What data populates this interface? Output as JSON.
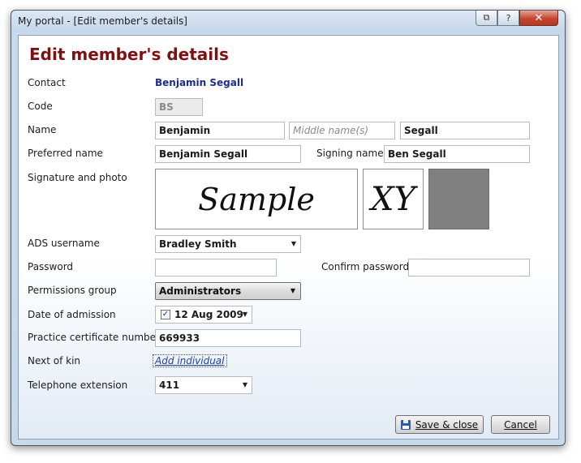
{
  "window": {
    "title": "My portal - [Edit member's details]",
    "controls": {
      "restore": "⧉",
      "help": "?",
      "close": "✕"
    }
  },
  "form": {
    "heading": "Edit member's details",
    "contact": {
      "label": "Contact",
      "value": "Benjamin Segall"
    },
    "code": {
      "label": "Code",
      "value": "BS"
    },
    "name": {
      "label": "Name",
      "first": "Benjamin",
      "middle_placeholder": "Middle name(s)",
      "last": "Segall"
    },
    "preferred_name": {
      "label": "Preferred name",
      "value": "Benjamin Segall"
    },
    "signing_name": {
      "label": "Signing name",
      "value": "Ben Segall"
    },
    "signature_photo": {
      "label": "Signature and photo",
      "signature_text": "Sample",
      "initials_text": "XY"
    },
    "ads_username": {
      "label": "ADS username",
      "value": "Bradley Smith"
    },
    "password": {
      "label": "Password",
      "value": ""
    },
    "confirm_password": {
      "label": "Confirm password",
      "value": ""
    },
    "permissions_group": {
      "label": "Permissions group",
      "value": "Administrators"
    },
    "date_of_admission": {
      "label": "Date of admission",
      "value": "12 Aug 2009",
      "checked": true
    },
    "practice_certificate": {
      "label": "Practice certificate number",
      "value": "669933"
    },
    "next_of_kin": {
      "label": "Next of kin",
      "link": "Add individual"
    },
    "telephone_extension": {
      "label": "Telephone extension",
      "value": "411"
    },
    "checkbox_glyph": "✓",
    "dropdown_glyph": "▼"
  },
  "actions": {
    "save_label": "Save & close",
    "cancel_label": "Cancel"
  },
  "colors": {
    "heading": "#7d1111",
    "contact_value": "#1f2b8a",
    "close_button": "#c5462e"
  },
  "icons": {
    "save": "floppy-disk-icon"
  }
}
